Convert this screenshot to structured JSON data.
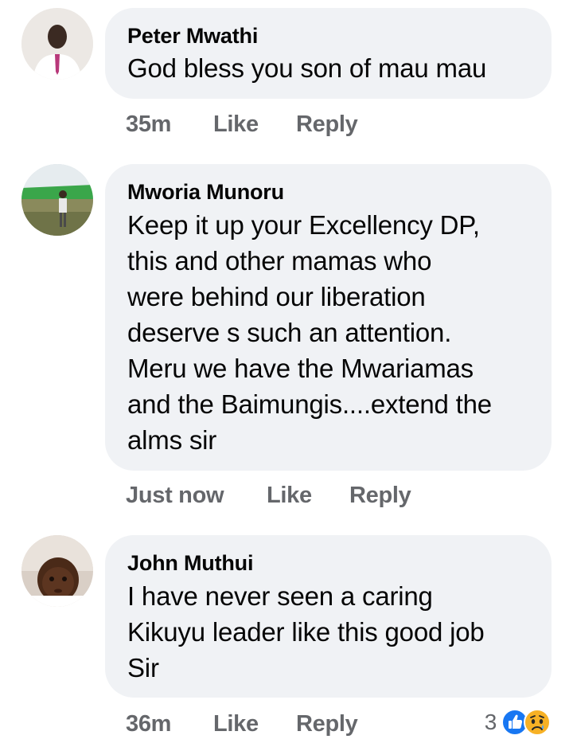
{
  "comments": [
    {
      "author": "Peter Mwathi",
      "text_lines": [
        "God bless you son of mau mau"
      ],
      "time": "35m",
      "like_label": "Like",
      "reply_label": "Reply"
    },
    {
      "author": "Mworia Munoru",
      "text_lines": [
        "Keep it up your Excellency DP,",
        "this and other mamas who",
        "were behind our liberation",
        "deserve s such an attention.",
        "Meru we have the Mwariamas",
        "and the Baimungis....extend the",
        "alms sir"
      ],
      "time": "Just now",
      "like_label": "Like",
      "reply_label": "Reply"
    },
    {
      "author": "John Muthui",
      "text_lines": [
        "I have never seen a caring",
        "Kikuyu leader like this good job",
        "Sir"
      ],
      "time": "36m",
      "like_label": "Like",
      "reply_label": "Reply",
      "reaction_count": "3",
      "reaction_icons": [
        "like-icon",
        "sad-icon"
      ]
    }
  ],
  "colors": {
    "bubble_bg": "#f0f2f5",
    "meta_text": "#65676b",
    "like_blue": "#1877f2",
    "sad_yellow": "#f7b125"
  }
}
